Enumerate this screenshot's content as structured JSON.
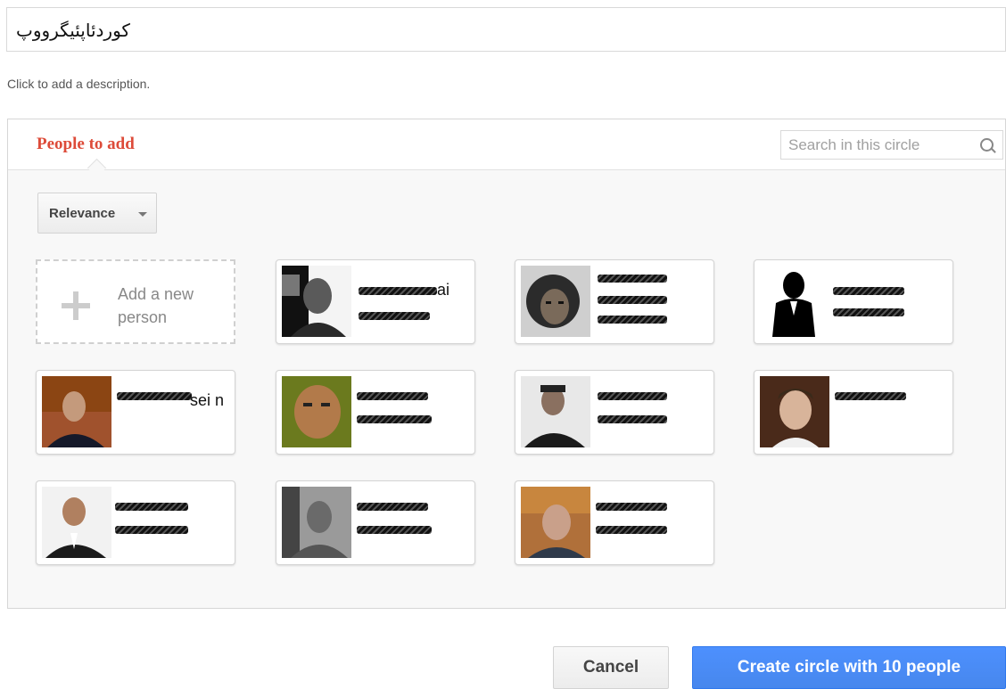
{
  "circle": {
    "name": "کوردئاپئیگرووپ",
    "description_prompt": "Click to add a description."
  },
  "panel": {
    "title": "People to add",
    "search_placeholder": "Search in this circle",
    "sort_label": "Relevance",
    "add_person_label": "Add a new person"
  },
  "people": [
    {
      "name_fragment": "ai"
    },
    {
      "name_fragment": ""
    },
    {
      "name_fragment": ""
    },
    {
      "name_fragment": "sei n"
    },
    {
      "name_fragment": ""
    },
    {
      "name_fragment": ""
    },
    {
      "name_fragment": ""
    },
    {
      "name_fragment": ""
    },
    {
      "name_fragment": ""
    },
    {
      "name_fragment": ""
    }
  ],
  "footer": {
    "cancel_label": "Cancel",
    "create_label": "Create circle with 10 people"
  },
  "colors": {
    "accent_red": "#dd4b39",
    "primary_blue": "#4d90fe"
  }
}
